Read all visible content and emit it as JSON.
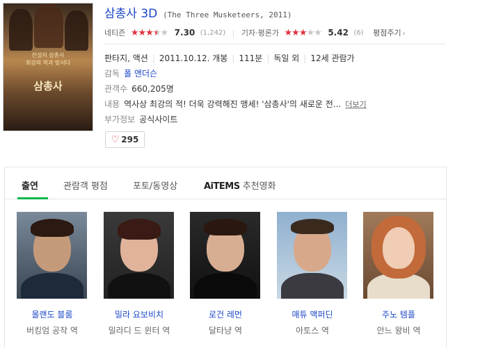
{
  "movie": {
    "title": "삼총사 3D",
    "subtitle": "(The Three Musketeers, 2011)",
    "poster_text": [
      "전설의 삼총사",
      "최강의 적과 맞서다"
    ],
    "poster_title": "삼총사"
  },
  "ratings": {
    "netizen": {
      "label": "네티즌",
      "stars_filled": 3.5,
      "score": "7.30",
      "count": "(1,242)"
    },
    "critic": {
      "label": "기자·평론가",
      "stars_filled": 3,
      "score": "5.42",
      "count": "(6)"
    },
    "rate_button": "평점주기",
    "rate_chevron": "›"
  },
  "info": {
    "genre": "판타지, 액션",
    "release": "2011.10.12. 개봉",
    "runtime": "111분",
    "country": "독일 외",
    "age": "12세 관람가",
    "director_label": "감독",
    "director": "폴 앤더슨",
    "audience_label": "관객수",
    "audience": "660,205명",
    "content_label": "내용",
    "content": "역사상 최강의 적! 더욱 강력해진 맹세! '삼총사'의 새로운 전...",
    "more": "더보기",
    "extra_label": "부가정보",
    "extra": "공식사이트"
  },
  "like": {
    "icon": "heart-icon",
    "glyph": "♡",
    "count": "295"
  },
  "tabs": [
    {
      "label": "출연",
      "active": true
    },
    {
      "label": "관람객 평점",
      "active": false
    },
    {
      "label": "포토/동영상",
      "active": false
    },
    {
      "label_logo": "AiTEMS",
      "label": "추천영화",
      "active": false
    }
  ],
  "cast": [
    {
      "name": "올랜도 블룸",
      "role": "버킹엄 공작 역"
    },
    {
      "name": "밀라 요보비치",
      "role": "밀라디 드 윈터 역"
    },
    {
      "name": "로건 레먼",
      "role": "달타냥 역"
    },
    {
      "name": "매튜 맥퍼딘",
      "role": "아토스 역"
    },
    {
      "name": "주노 템플",
      "role": "안느 왕비 역"
    }
  ],
  "colors": {
    "link_blue": "#1a46c8",
    "star_red": "#e0313e",
    "tab_green": "#00b84c"
  }
}
